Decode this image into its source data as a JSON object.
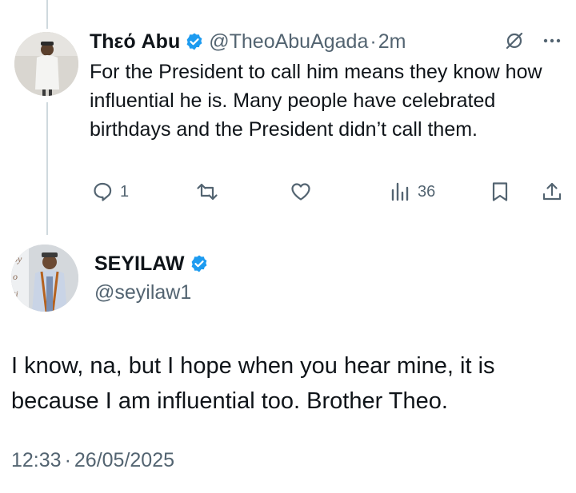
{
  "reply": {
    "display_name": "Thεό Abu",
    "handle": "@TheoAbuAgada",
    "separator": "·",
    "time": "2m",
    "text": "For the President to call him means they know how influential he is. Many people have celebrated birthdays and the President didn’t call them.",
    "stats": {
      "replies": "1",
      "views": "36"
    }
  },
  "main_tweet": {
    "display_name": "SEYILAW",
    "handle": "@seyilaw1",
    "text": "I know, na, but I hope when you hear mine, it is because I am influential too. Brother Theo.",
    "time": "12:33",
    "separator": "·",
    "date": "26/05/2025"
  },
  "colors": {
    "verified": "#1d9bf0",
    "muted": "#536471",
    "thread_line": "#cfd9de"
  },
  "icons": [
    "verified-badge-icon",
    "grok-icon",
    "more-icon",
    "reply-icon",
    "retweet-icon",
    "like-icon",
    "views-icon",
    "bookmark-icon",
    "share-icon"
  ]
}
